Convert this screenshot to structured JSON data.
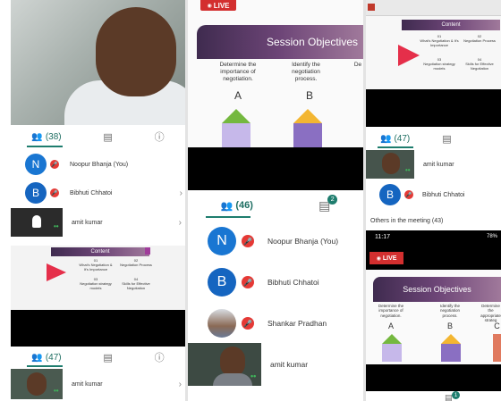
{
  "left": {
    "tabs": {
      "participants_count": "(38)"
    },
    "participants": [
      {
        "initial": "N",
        "name": "Noopur Bhanja (You)",
        "color": "#1976d2"
      },
      {
        "initial": "B",
        "name": "Bibhuti Chhatoi",
        "color": "#1565c0"
      },
      {
        "name": "amit kumar"
      }
    ],
    "mini_slide": {
      "title": "Content",
      "items": [
        "What's Negotiation & It's Importance",
        "Negotiation Process",
        "Negotiation strategy models",
        "Skills for Effective Negotiation"
      ],
      "nums": [
        "01",
        "02",
        "03",
        "04"
      ]
    },
    "tabs2": {
      "participants_count": "(47)"
    },
    "bottom_participant": "amit kumar"
  },
  "middle": {
    "live_label": "LIVE",
    "slide": {
      "title": "Session Objectives",
      "col1": "Determine the importance of negotiation.",
      "col2": "Identify the negotiation process.",
      "col3": "De",
      "letter1": "A",
      "letter2": "B"
    },
    "tabs": {
      "participants_count": "(46)",
      "chat_badge": "2"
    },
    "participants": [
      {
        "initial": "N",
        "name": "Noopur Bhanja (You)",
        "color": "#1976d2"
      },
      {
        "initial": "B",
        "name": "Bibhuti Chhatoi",
        "color": "#1565c0"
      },
      {
        "name": "Shankar Pradhan"
      },
      {
        "name": "amit kumar"
      }
    ]
  },
  "right": {
    "mini_slide": {
      "title": "Content",
      "items": [
        "What's Negotiation & It's Importance",
        "Negotiation Process",
        "Negotiation strategy models",
        "Skills for Effective Negotiation"
      ],
      "nums": [
        "01",
        "02",
        "03",
        "04"
      ]
    },
    "tabs": {
      "participants_count": "(47)"
    },
    "participants": [
      {
        "name": "amit kumar"
      },
      {
        "initial": "B",
        "name": "Bibhuti Chhatoi",
        "color": "#1565c0"
      }
    ],
    "others_label": "Others in the meeting (43)",
    "phone": {
      "time": "11:17",
      "battery": "78%",
      "live_label": "LIVE",
      "slide_title": "Session Objectives",
      "col1": "Determine the importance of negotiation.",
      "col2": "Identify the negotiation process.",
      "col3": "Determine the appropriate strateg",
      "letter1": "A",
      "letter2": "B",
      "letter3": "C"
    },
    "bottom_badge": "1"
  },
  "colors": {
    "accent": "#1e7d6e",
    "mic_off": "#e53935",
    "live": "#d32f2f"
  }
}
